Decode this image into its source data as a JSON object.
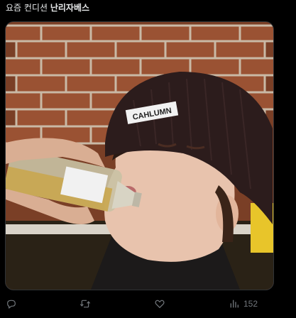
{
  "tweet": {
    "text_plain": "요즘 컨디션 ",
    "text_bold": "난리자베스"
  },
  "media": {
    "description_alt": "",
    "beanie_label": "CAHLUMN"
  },
  "actions": {
    "reply_icon": "reply-icon",
    "retweet_icon": "retweet-icon",
    "like_icon": "heart-icon",
    "views_icon": "views-icon",
    "views_count": "152"
  },
  "colors": {
    "background": "#000000",
    "text": "#e7e9ea",
    "muted": "#71767b"
  }
}
